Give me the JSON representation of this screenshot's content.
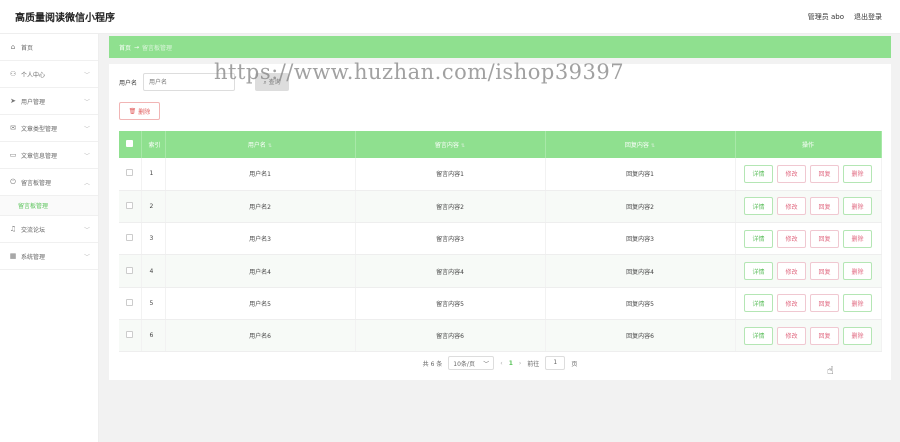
{
  "header": {
    "app_title": "高质量阅读微信小程序",
    "user": "管理员 abo",
    "logout": "退出登录"
  },
  "sidebar": {
    "items": [
      {
        "label": "首页",
        "icon": "home-icon",
        "glyph": "⌂"
      },
      {
        "label": "个人中心",
        "icon": "user-icon",
        "glyph": "⚇"
      },
      {
        "label": "用户管理",
        "icon": "send-icon",
        "glyph": "➤"
      },
      {
        "label": "文章类型管理",
        "icon": "mail-icon",
        "glyph": "✉"
      },
      {
        "label": "文章信息管理",
        "icon": "chat-icon",
        "glyph": "▭"
      },
      {
        "label": "留言板管理",
        "icon": "power-icon",
        "glyph": "⏻"
      },
      {
        "label": "交流论坛",
        "icon": "mic-icon",
        "glyph": "♫"
      },
      {
        "label": "系统管理",
        "icon": "grid-icon",
        "glyph": "▦"
      }
    ],
    "sub_item": "留言板管理"
  },
  "breadcrumb": {
    "home": "首页",
    "separator": "→",
    "current": "留言板管理"
  },
  "search": {
    "label": "用户名",
    "placeholder": "用户名",
    "button": "查询"
  },
  "delete_button": "删除",
  "watermark": "https://www.huzhan.com/ishop39397",
  "table": {
    "columns": [
      "索引",
      "用户名",
      "留言内容",
      "回复内容",
      "操作"
    ],
    "rows": [
      {
        "index": "1",
        "username": "用户名1",
        "message": "留言内容1",
        "reply": "回复内容1"
      },
      {
        "index": "2",
        "username": "用户名2",
        "message": "留言内容2",
        "reply": "回复内容2"
      },
      {
        "index": "3",
        "username": "用户名3",
        "message": "留言内容3",
        "reply": "回复内容3"
      },
      {
        "index": "4",
        "username": "用户名4",
        "message": "留言内容4",
        "reply": "回复内容4"
      },
      {
        "index": "5",
        "username": "用户名5",
        "message": "留言内容5",
        "reply": "回复内容5"
      },
      {
        "index": "6",
        "username": "用户名6",
        "message": "留言内容6",
        "reply": "回复内容6"
      }
    ],
    "actions": {
      "detail": "详情",
      "edit": "修改",
      "reply": "回复",
      "remove": "删除"
    }
  },
  "pagination": {
    "total": "共 6 条",
    "page_size": "10条/页",
    "current_page": "1",
    "goto_label": "前往",
    "goto_value": "1",
    "page_suffix": "页"
  },
  "colors": {
    "accent": "#8fe08f",
    "danger": "#e05a5a"
  }
}
